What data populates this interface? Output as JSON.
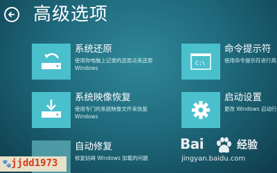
{
  "page": {
    "title": "高级选项"
  },
  "options": [
    {
      "title": "系统还原",
      "desc": "使用你电脑上记录的还原点来还原 Windows",
      "icon": "system-restore-icon"
    },
    {
      "title": "命令提示符",
      "desc": "使用命令提示符进行高",
      "icon": "command-prompt-icon",
      "tile_text": "C:\\"
    },
    {
      "title": "系统映像恢复",
      "desc": "使用专门的系统映像文件来恢复 Windows",
      "icon": "system-image-recovery-icon"
    },
    {
      "title": "启动设置",
      "desc": "更改 Windows 启动行",
      "icon": "gear-icon"
    },
    {
      "title": "自动修复",
      "desc": "修复妨碍 Windows 加载的问题",
      "icon": "automatic-repair-icon"
    }
  ],
  "watermark": {
    "user": "jjdd1973",
    "brand": "Bai",
    "brand_suffix": "经验",
    "url": "jingyan.baidu.com"
  },
  "colors": {
    "tile": "#4bc0cd",
    "background": "#1f6b7d",
    "accent_user": "#d43a1e"
  }
}
